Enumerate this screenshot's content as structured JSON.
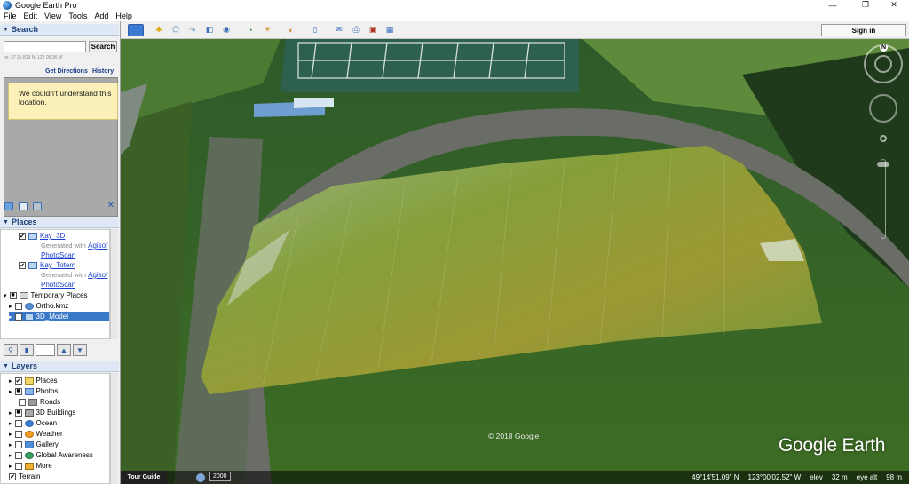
{
  "window": {
    "title": "Google Earth Pro",
    "minimize": "—",
    "maximize": "❐",
    "close": "✕"
  },
  "menu": [
    "File",
    "Edit",
    "View",
    "Tools",
    "Add",
    "Help"
  ],
  "search": {
    "header": "Search",
    "button": "Search",
    "hint": "ex: 37 25.819 N, 122 05.36 W",
    "get_directions": "Get Directions",
    "history": "History",
    "notice": "We couldn't understand this location."
  },
  "places": {
    "header": "Places",
    "items": [
      {
        "label": "Kay_3D",
        "sub": "Generated with",
        "link1": "Agisof",
        "link2": "PhotoScan"
      },
      {
        "label": "Kay_Totem",
        "sub": "Generated with",
        "link1": "Agisof",
        "link2": "PhotoScan"
      }
    ],
    "temporary": "Temporary Places",
    "ortho": "Ortho.kmz",
    "model": "3D_Model"
  },
  "layers": {
    "header": "Layers",
    "items": [
      "Places",
      "Photos",
      "Roads",
      "3D Buildings",
      "Ocean",
      "Weather",
      "Gallery",
      "Global Awareness",
      "More",
      "Terrain"
    ]
  },
  "toolbar": {
    "signin": "Sign in"
  },
  "status": {
    "tour_guide": "Tour Guide",
    "year": "2000",
    "lat": "49°14'51.09\" N",
    "lon": "123°00'02.52\" W",
    "elev_label": "elev",
    "elev": "32 m",
    "eye_label": "eye alt",
    "eye": "98 m"
  },
  "map": {
    "copyright": "© 2018 Google",
    "brand": "Google Earth",
    "compass_n": "N"
  }
}
